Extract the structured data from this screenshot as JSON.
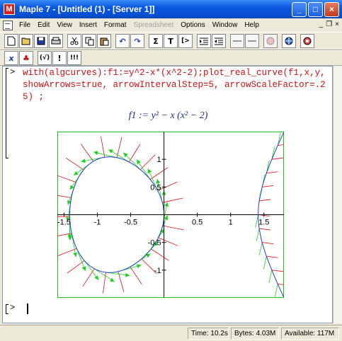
{
  "window": {
    "title": "Maple 7  - [Untitled (1) - [Server 1]]",
    "app_icon_letter": "M",
    "minimize": "_",
    "maximize": "□",
    "close": "×"
  },
  "menubar": {
    "items": [
      "File",
      "Edit",
      "View",
      "Insert",
      "Format",
      "Spreadsheet",
      "Options",
      "Window",
      "Help"
    ],
    "disabled": [
      "Spreadsheet"
    ],
    "mdi_min": "_",
    "mdi_restore": "❐",
    "mdi_close": "×"
  },
  "toolbar": {
    "buttons": [
      "new-icon",
      "open-icon",
      "save-icon",
      "print-icon",
      "cut-icon",
      "copy-icon",
      "paste-icon",
      "undo-icon",
      "redo-icon",
      "sum-icon",
      "text-icon",
      "prompt-icon",
      "indent-icon",
      "outdent-icon",
      "back-icon",
      "forward-icon",
      "stop-icon",
      "zoom-icon",
      "help-icon"
    ],
    "glyphs": {
      "sum": "Σ",
      "text": "T",
      "prompt": "[>",
      "undo": "↶",
      "redo": "↷"
    }
  },
  "toolbar2": {
    "glyphs": {
      "x": "x",
      "leaf": "♣",
      "sqrt": "(√)",
      "exec": "!",
      "exec_all": "!!!"
    }
  },
  "worksheet": {
    "prompt": ">",
    "command": "with(algcurves):f1:=y^2-x*(x^2-2);plot_real_curve(f1,x,y,showArrows=true, arrowIntervalStep=5, arrowScaleFactor=.25) ;",
    "output": "f1 := y² − x (x² − 2)",
    "cursor_prompt": ">"
  },
  "chart_data": {
    "type": "line",
    "title": "",
    "xlabel": "",
    "ylabel": "",
    "xlim": [
      -1.6,
      1.8
    ],
    "ylim": [
      -1.5,
      1.5
    ],
    "x_ticks": [
      -1.5,
      -1,
      -0.5,
      0.5,
      1,
      1.5
    ],
    "x_tick_labels": [
      "-1.5",
      "-1",
      "-0.5",
      "0.5",
      "1",
      "1.5"
    ],
    "y_ticks": [
      1,
      0.5,
      -0.5,
      -1
    ],
    "y_tick_labels": [
      "1",
      "0.5",
      "-0.5",
      "-1"
    ],
    "curve": "y^2 - x*(x^2-2) = 0",
    "curve_color": "#1f3fd0",
    "arrow_colors": {
      "tangent": "#20d020",
      "normal": "#e01010"
    }
  },
  "status": {
    "time": "Time: 10.2s",
    "bytes": "Bytes: 4.03M",
    "available": "Available: 117M"
  }
}
